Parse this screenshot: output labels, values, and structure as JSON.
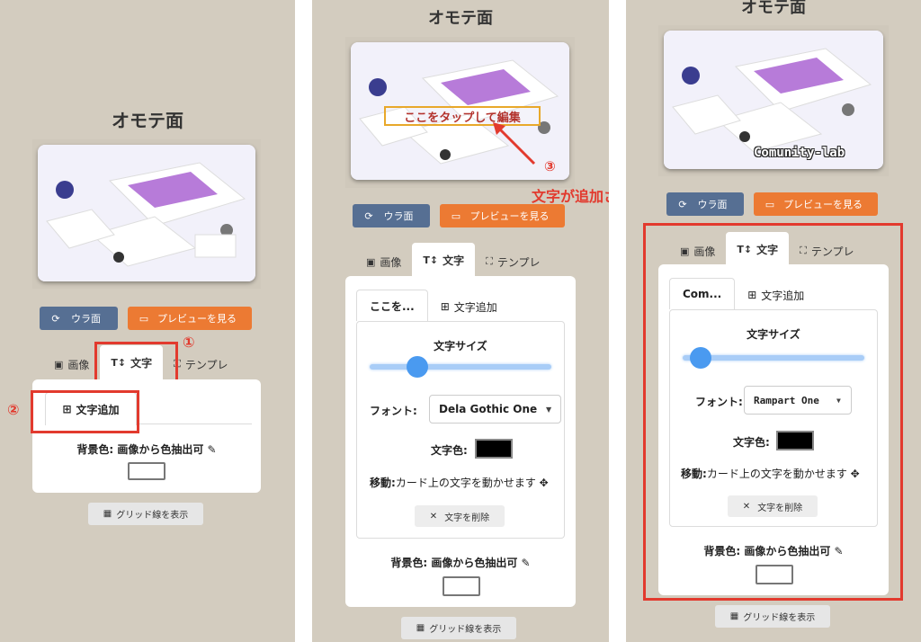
{
  "colors": {
    "background": "#d3ccbf",
    "accent_blue": "#566f93",
    "accent_orange": "#ec7a33",
    "annotation_red": "#e23a2e",
    "slider": "#4a9af0"
  },
  "common": {
    "title": "オモテ面",
    "flip_button": "ウラ面",
    "preview_button": "プレビューを見る",
    "tabs": {
      "image": "画像",
      "text": "文字",
      "template": "テンプレ"
    },
    "add_text": "文字追加",
    "bg_color_label": "背景色: 画像から色抽出可",
    "grid_button": "グリッド線を表示",
    "font_size_label": "文字サイズ",
    "font_label": "フォント:",
    "text_color_label": "文字色:",
    "move_label": "移動:",
    "move_desc": "カード上の文字を動かせます",
    "delete_text": "文字を削除"
  },
  "icons": [
    "sync-icon",
    "id-card-icon",
    "image-icon",
    "text-size-icon",
    "expand-icon",
    "plus-square-icon",
    "eyedropper-icon",
    "move-icon",
    "close-icon",
    "grid-icon",
    "arrow-icon"
  ],
  "panel1": {
    "annotation_1": "①",
    "annotation_2": "②"
  },
  "panel2": {
    "overlay_text": "ここをタップして編集",
    "annotation_3": "③",
    "annotation_caption": "文字が追加される",
    "subtab_label": "ここを...",
    "font_value": "Dela Gothic One"
  },
  "panel3": {
    "overlay_text": "Comunity-lab",
    "subtab_label": "Com...",
    "font_value": "Rampart One"
  }
}
